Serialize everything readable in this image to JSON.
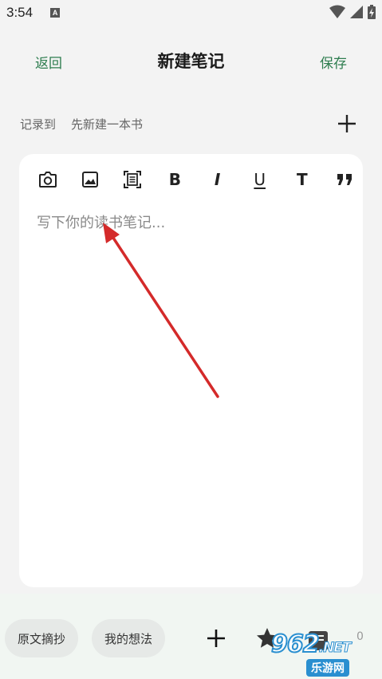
{
  "status_bar": {
    "time": "3:54",
    "notification_icon": "a-icon"
  },
  "header": {
    "back_label": "返回",
    "title": "新建笔记",
    "save_label": "保存"
  },
  "record": {
    "label": "记录到",
    "book": "先新建一本书"
  },
  "toolbar": {
    "icons": [
      "camera-icon",
      "image-icon",
      "scan-icon",
      "bold-icon",
      "italic-icon",
      "underline-icon",
      "text-icon",
      "quote-icon"
    ],
    "bold": "B",
    "italic": "I",
    "underline": "U",
    "text": "T"
  },
  "editor": {
    "placeholder": "写下你的读书笔记...",
    "value": ""
  },
  "bottom_bar": {
    "quote_label": "原文摘抄",
    "idea_label": "我的想法",
    "count": "0"
  },
  "watermark": {
    "logo_main": "962",
    "logo_suffix": ".NET",
    "sub": "乐游网"
  },
  "colors": {
    "accent": "#2e7d4f",
    "arrow": "#d42a2a",
    "card": "#ffffff",
    "background": "#f3f3f3"
  }
}
